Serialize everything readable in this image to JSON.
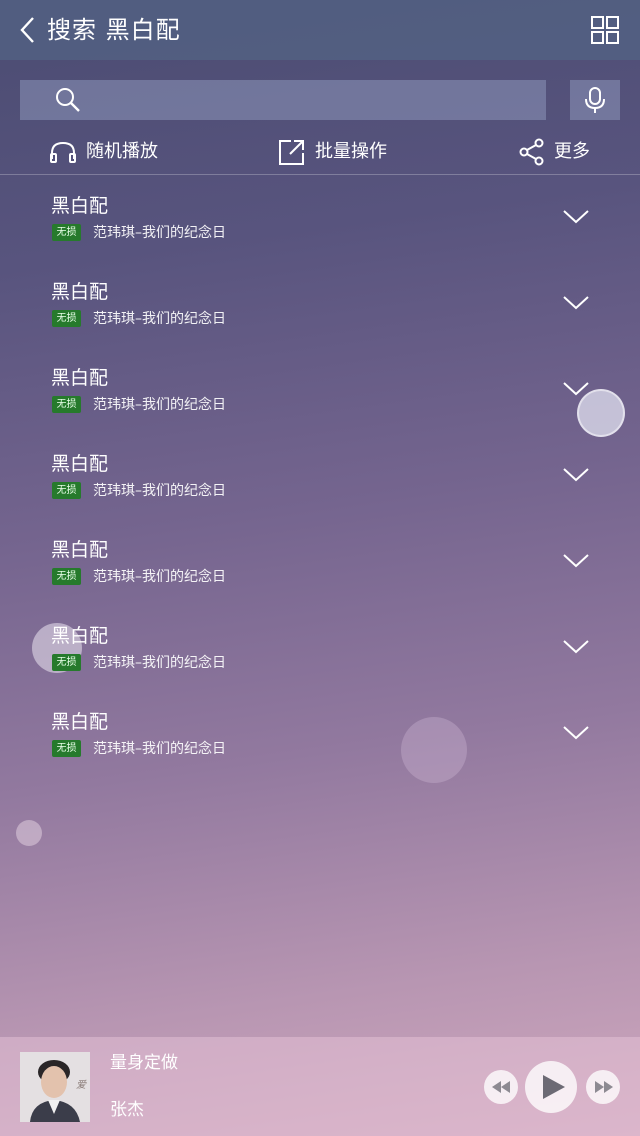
{
  "header": {
    "title": "搜索 黑白配",
    "back_icon": "chevron-left-icon",
    "grid_icon": "grid-icon"
  },
  "search": {
    "value": "",
    "placeholder": "",
    "icon": "search-icon",
    "mic_icon": "microphone-icon"
  },
  "actions": {
    "shuffle_label": "随机播放",
    "batch_label": "批量操作",
    "more_label": "更多"
  },
  "songs": [
    {
      "title": "黑白配",
      "badge": "无损",
      "subtitle": "范玮琪–我们的纪念日"
    },
    {
      "title": "黑白配",
      "badge": "无损",
      "subtitle": "范玮琪–我们的纪念日"
    },
    {
      "title": "黑白配",
      "badge": "无损",
      "subtitle": "范玮琪–我们的纪念日"
    },
    {
      "title": "黑白配",
      "badge": "无损",
      "subtitle": "范玮琪–我们的纪念日"
    },
    {
      "title": "黑白配",
      "badge": "无损",
      "subtitle": "范玮琪–我们的纪念日"
    },
    {
      "title": "黑白配",
      "badge": "无损",
      "subtitle": "范玮琪–我们的纪念日"
    },
    {
      "title": "黑白配",
      "badge": "无损",
      "subtitle": "范玮琪–我们的纪念日"
    }
  ],
  "player": {
    "song_title": "量身定做",
    "artist": "张杰",
    "cover_text": "爱"
  },
  "colors": {
    "header_bg": "#526082",
    "badge_green": "#267a2c",
    "player_bg": "#ebc8dc"
  }
}
